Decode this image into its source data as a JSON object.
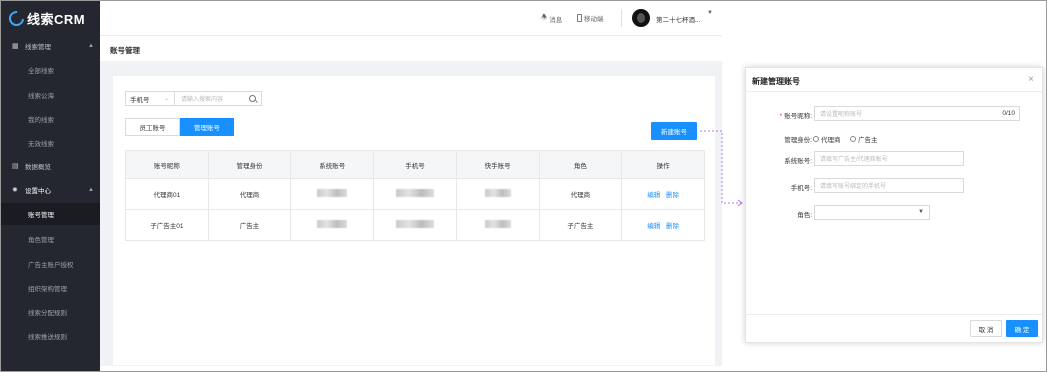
{
  "brand": {
    "logo_text": "线索CRM",
    "accent": "#1890ff",
    "sidebar_bg": "#24272f"
  },
  "sidebar": {
    "groups": [
      {
        "label": "线索管理",
        "icon": "doc-icon"
      },
      {
        "label": "数据概览",
        "icon": "chart-icon"
      },
      {
        "label": "设置中心",
        "icon": "gear-icon"
      }
    ],
    "lead_items": [
      "全部线索",
      "线索公海",
      "我的线索",
      "无效线索"
    ],
    "settings_items": [
      "账号管理",
      "角色管理",
      "广告主账户授权",
      "组织架构管理",
      "线索分配规则",
      "线索推送规则"
    ],
    "active_item": "账号管理"
  },
  "header": {
    "messages": "消息",
    "mobile": "移动端",
    "username": "第二十七杯酒..."
  },
  "page": {
    "title": "账号管理",
    "filter": {
      "select_value": "手机号",
      "search_placeholder": "请输入搜索内容"
    },
    "tabs": [
      "员工账号",
      "管理账号"
    ],
    "active_tab": "管理账号",
    "new_button": "新建账号",
    "table": {
      "columns": [
        "账号昵称",
        "管理身份",
        "系统账号",
        "手机号",
        "快手账号",
        "角色",
        "操作"
      ],
      "rows": [
        {
          "nickname": "代理商01",
          "identity": "代理商",
          "role": "代理商",
          "actions": [
            "编辑",
            "删除"
          ]
        },
        {
          "nickname": "子广告主01",
          "identity": "广告主",
          "role": "子广告主",
          "actions": [
            "编辑",
            "删除"
          ]
        }
      ]
    }
  },
  "modal": {
    "title": "新建管理账号",
    "nickname_label": "账号昵称:",
    "nickname_placeholder": "请设置昵称账号",
    "nickname_count": "0/10",
    "identity_label": "管理身份:",
    "identity_options": [
      "代理商",
      "广告主"
    ],
    "system_account_label": "系统账号:",
    "system_account_placeholder": "请填写广告主/代理商账号",
    "phone_label": "手机号:",
    "phone_placeholder": "请填写账号绑定的手机号",
    "role_label": "角色:",
    "cancel": "取 消",
    "ok": "确 定"
  }
}
